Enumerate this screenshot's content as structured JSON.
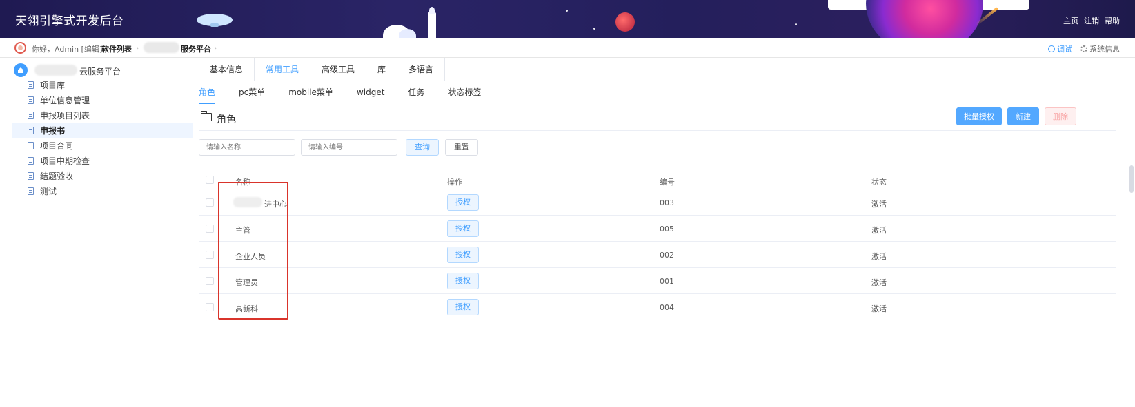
{
  "header": {
    "app_title": "天翎引擎式开发后台",
    "links": [
      "主页",
      "注销",
      "帮助"
    ]
  },
  "crumbbar": {
    "greeting": "你好，Admin [编辑]",
    "crumb1": "软件列表",
    "crumb2": "服务平台",
    "debug": "调试",
    "sysinfo": "系统信息"
  },
  "sidebar": {
    "root_label": "云服务平台",
    "items": [
      {
        "label": "项目库"
      },
      {
        "label": "单位信息管理"
      },
      {
        "label": "申报项目列表"
      },
      {
        "label": "申报书"
      },
      {
        "label": "项目合同"
      },
      {
        "label": "项目中期检查"
      },
      {
        "label": "结题验收"
      },
      {
        "label": "测试"
      }
    ]
  },
  "tabs_primary": [
    "基本信息",
    "常用工具",
    "高级工具",
    "库",
    "多语言"
  ],
  "tabs_secondary": [
    "角色",
    "pc菜单",
    "mobile菜单",
    "widget",
    "任务",
    "状态标签"
  ],
  "section": {
    "title": "角色",
    "batch_auth": "批量授权",
    "new": "新建",
    "delete": "删除"
  },
  "search": {
    "name_placeholder": "请输入名称",
    "code_placeholder": "请输入编号",
    "query": "查询",
    "reset": "重置"
  },
  "table": {
    "headers": {
      "name": "名称",
      "op": "操作",
      "code": "编号",
      "status": "状态"
    },
    "auth_label": "授权",
    "rows": [
      {
        "name": "进中心",
        "code": "003",
        "status": "激活"
      },
      {
        "name": "主管",
        "code": "005",
        "status": "激活"
      },
      {
        "name": "企业人员",
        "code": "002",
        "status": "激活"
      },
      {
        "name": "管理员",
        "code": "001",
        "status": "激活"
      },
      {
        "name": "高新科",
        "code": "004",
        "status": "激活"
      }
    ]
  },
  "colors": {
    "accent": "#409eff",
    "header_bg": "#241f5c",
    "highlight_box": "#d9342b"
  }
}
